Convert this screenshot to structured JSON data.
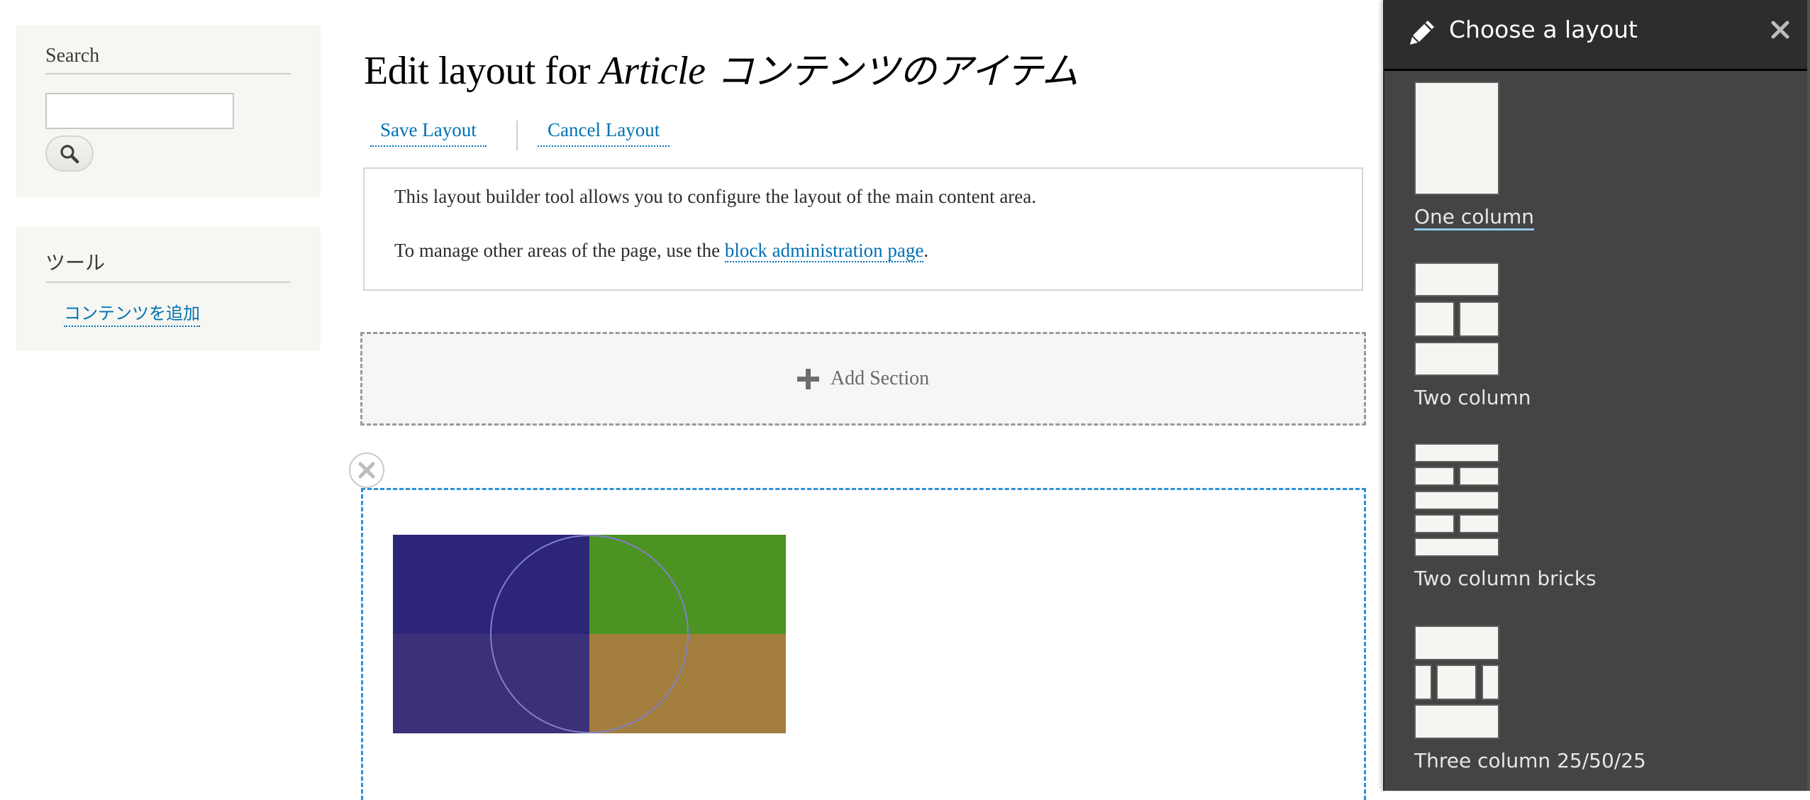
{
  "sidebar": {
    "search": {
      "title": "Search",
      "input_value": "",
      "input_placeholder": "",
      "button_icon": "search-icon"
    },
    "tools": {
      "title": "ツール",
      "links": [
        {
          "label": "コンテンツを追加"
        }
      ]
    }
  },
  "main": {
    "title_prefix": "Edit layout for ",
    "title_em": "Article",
    "title_suffix": " コンテンツのアイテム",
    "actions": {
      "save_label": "Save Layout",
      "cancel_label": "Cancel Layout"
    },
    "info": {
      "line1": "This layout builder tool allows you to configure the layout of the main content area.",
      "line2_prefix": "To manage other areas of the page, use the ",
      "line2_link": "block administration page",
      "line2_suffix": "."
    },
    "add_section_label": "Add Section",
    "remove_section_icon": "close-icon",
    "image": {
      "quadrant_colors": [
        "#2c2578",
        "#4c9323",
        "#3c3079",
        "#a47e3e"
      ],
      "circle_color": "#8080c8"
    }
  },
  "panel": {
    "title": "Choose a layout",
    "title_icon": "pencil-icon",
    "close_icon": "close-icon",
    "layouts": [
      {
        "label": "One column",
        "active": true
      },
      {
        "label": "Two column",
        "active": false
      },
      {
        "label": "Two column bricks",
        "active": false
      },
      {
        "label": "Three column 25/50/25",
        "active": false
      }
    ]
  },
  "colors": {
    "link": "#0071b3",
    "section_outline": "#2e91d8",
    "panel_bg": "#444444",
    "panel_header_bg": "#2d2d2d"
  }
}
